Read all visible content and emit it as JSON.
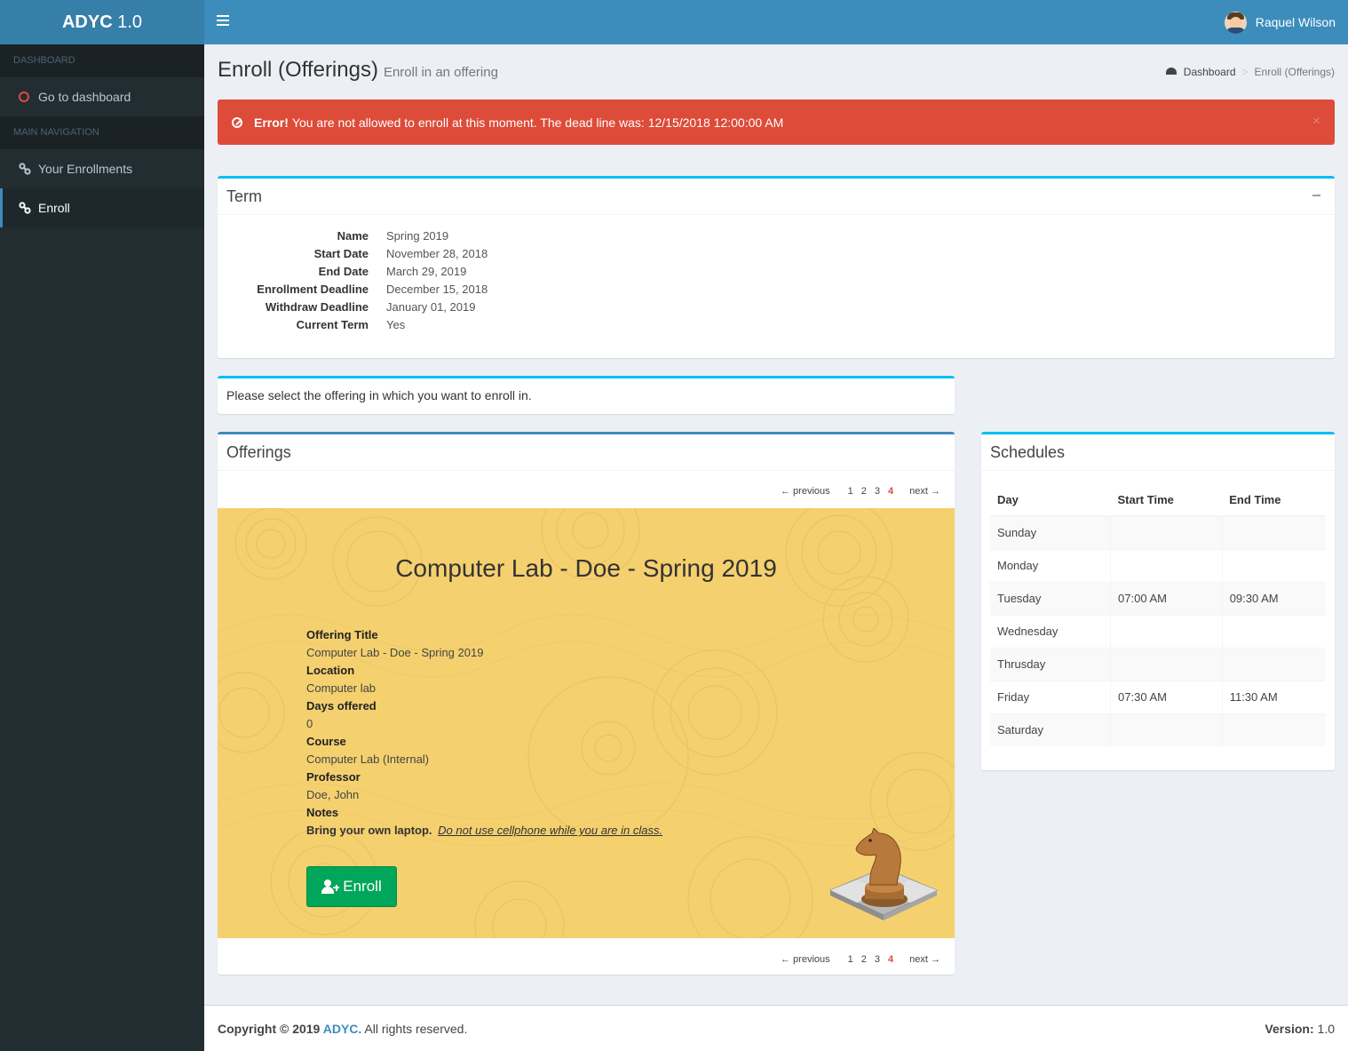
{
  "app": {
    "logo_bold": "ADYC",
    "logo_version": " 1.0"
  },
  "user": {
    "name": "Raquel Wilson"
  },
  "sidebar": {
    "sections": [
      {
        "header": "DASHBOARD"
      },
      {
        "header": "MAIN NAVIGATION"
      }
    ],
    "items": [
      {
        "label": "Go to dashboard",
        "icon": "circle-icon"
      },
      {
        "label": "Your Enrollments",
        "icon": "link-icon"
      },
      {
        "label": "Enroll",
        "icon": "link-icon",
        "active": true
      }
    ]
  },
  "page": {
    "title": "Enroll (Offerings)",
    "subtitle": "Enroll in an offering"
  },
  "breadcrumb": {
    "home": "Dashboard",
    "sep": ">",
    "current": "Enroll (Offerings)"
  },
  "alert": {
    "strong": "Error!",
    "message": "You are not allowed to enroll at this moment. The dead line was: 12/15/2018 12:00:00 AM",
    "close": "×",
    "color": "#dd4b39"
  },
  "term": {
    "title": "Term",
    "rows": [
      {
        "label": "Name",
        "value": "Spring 2019"
      },
      {
        "label": "Start Date",
        "value": "November 28, 2018"
      },
      {
        "label": "End Date",
        "value": "March 29, 2019"
      },
      {
        "label": "Enrollment Deadline",
        "value": "December 15, 2018"
      },
      {
        "label": "Withdraw Deadline",
        "value": "January 01, 2019"
      },
      {
        "label": "Current Term",
        "value": "Yes"
      }
    ]
  },
  "select_prompt": "Please select the offering in which you want to enroll in.",
  "offerings": {
    "title": "Offerings",
    "pager": {
      "previous": "← previous",
      "next": "next →",
      "pages": [
        "1",
        "2",
        "3",
        "4"
      ],
      "current": "4"
    },
    "card": {
      "title": "Computer Lab - Doe - Spring 2019",
      "fields": [
        {
          "label": "Offering Title",
          "value": "Computer Lab - Doe - Spring 2019"
        },
        {
          "label": "Location",
          "value": "Computer lab"
        },
        {
          "label": "Days offered",
          "value": "0"
        },
        {
          "label": "Course",
          "value": "Computer Lab (Internal)"
        },
        {
          "label": "Professor",
          "value": "Doe, John"
        }
      ],
      "notes_label": "Notes",
      "notes_bold": "Bring your own laptop.",
      "notes_italic": "Do not use cellphone while you are in class.",
      "enroll_label": "Enroll",
      "bg_color": "#f4d06f"
    }
  },
  "schedules": {
    "title": "Schedules",
    "columns": [
      "Day",
      "Start Time",
      "End Time"
    ],
    "rows": [
      [
        "Sunday",
        "",
        ""
      ],
      [
        "Monday",
        "",
        ""
      ],
      [
        "Tuesday",
        "07:00 AM",
        "09:30 AM"
      ],
      [
        "Wednesday",
        "",
        ""
      ],
      [
        "Thrusday",
        "",
        ""
      ],
      [
        "Friday",
        "07:30 AM",
        "11:30 AM"
      ],
      [
        "Saturday",
        "",
        ""
      ]
    ]
  },
  "footer": {
    "copyright": "Copyright © 2019 ",
    "brand": "ADYC.",
    "rights": " All rights reserved.",
    "version_label": "Version:",
    "version": " 1.0"
  }
}
